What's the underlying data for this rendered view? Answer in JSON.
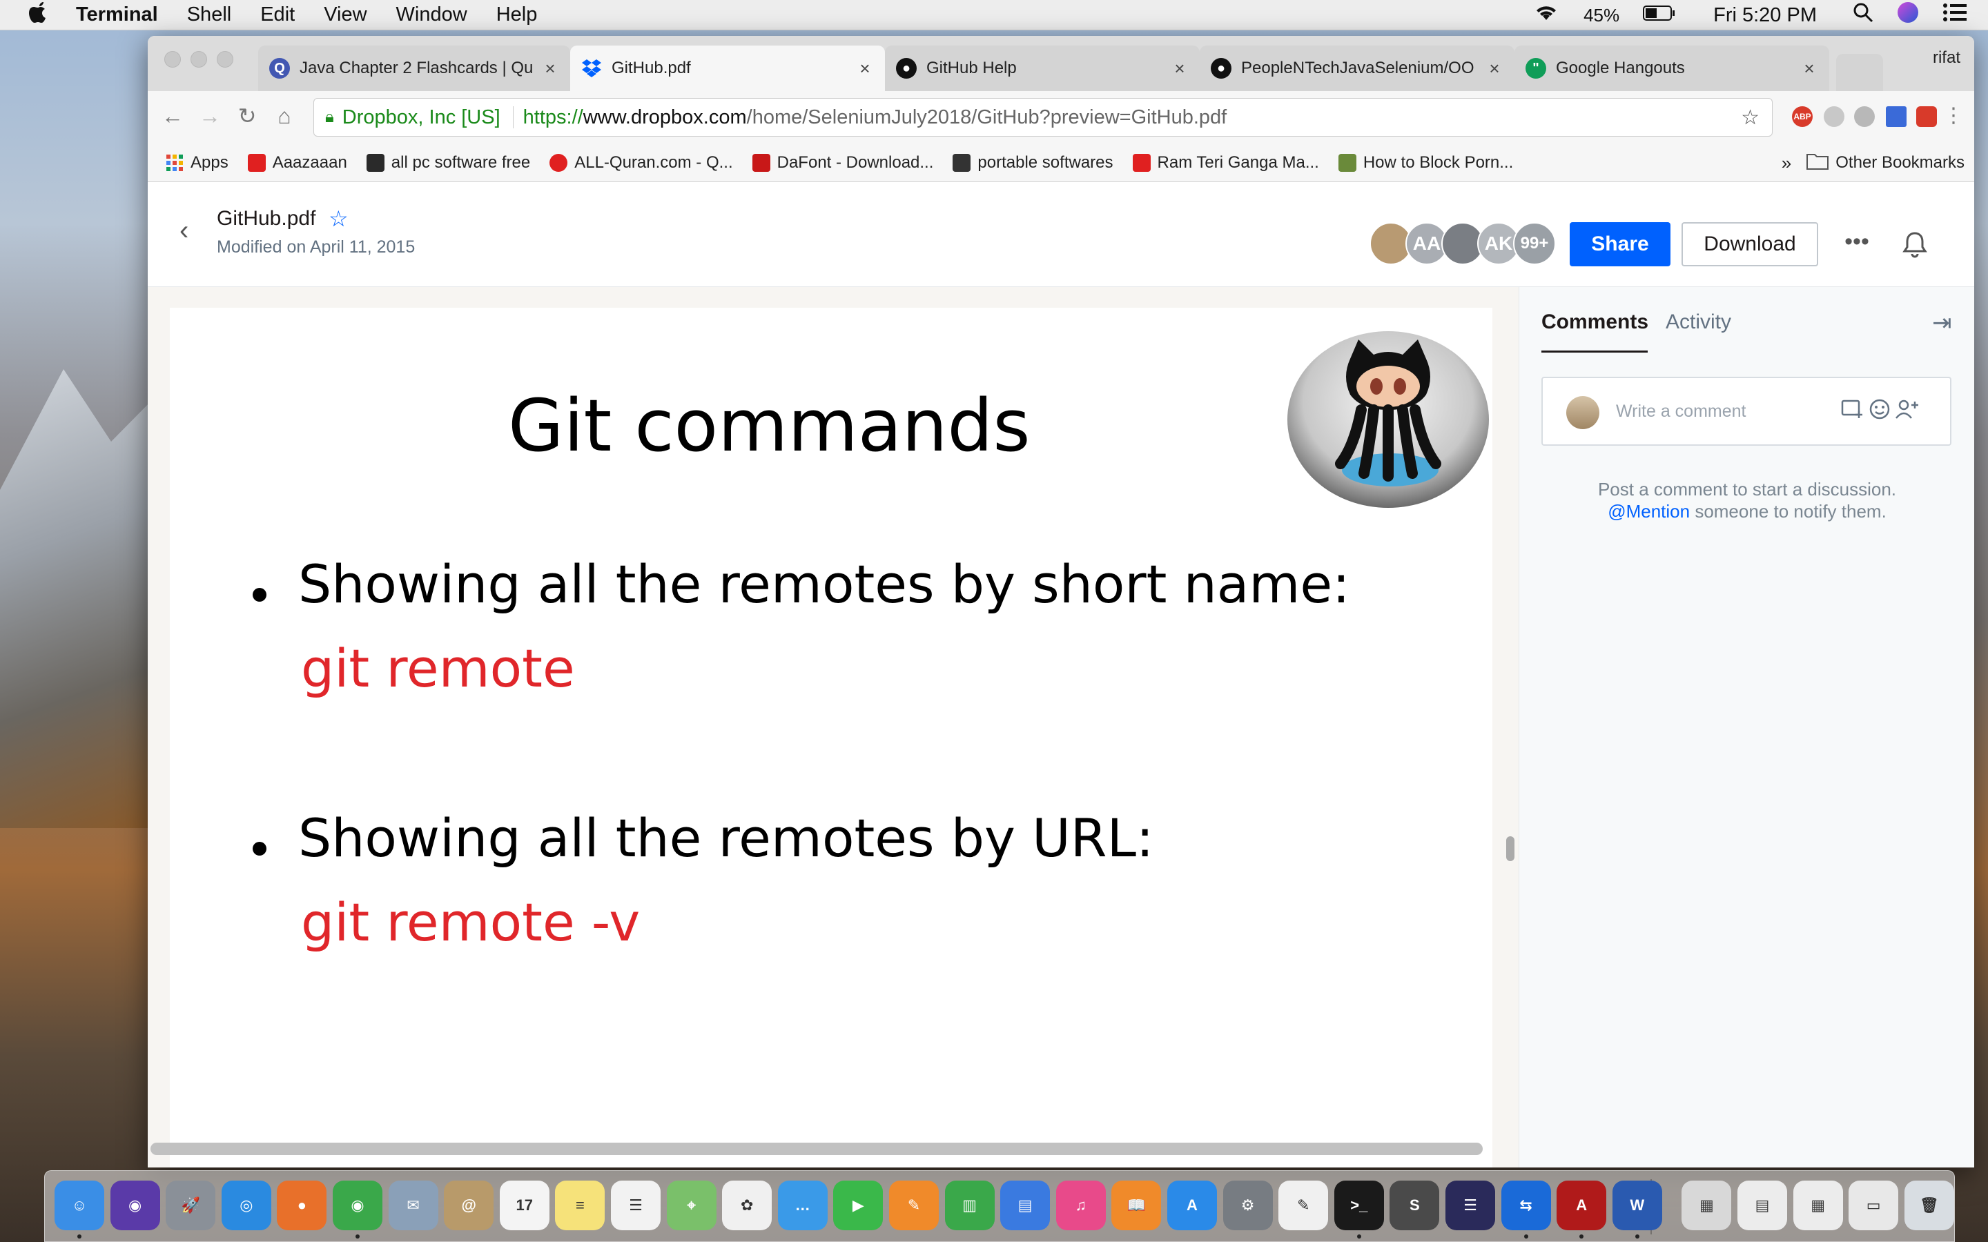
{
  "menubar": {
    "app_name": "Terminal",
    "items": [
      "Shell",
      "Edit",
      "View",
      "Window",
      "Help"
    ],
    "battery": "45%",
    "clock": "Fri 5:20 PM",
    "icons": [
      "apple-icon",
      "wifi-icon",
      "battery-icon",
      "spotlight-icon",
      "siri-icon",
      "notification-center-icon"
    ]
  },
  "browser": {
    "profile_name": "rifat",
    "tabs": [
      {
        "title": "Java Chapter 2 Flashcards | Qu",
        "icon": "quizlet-icon",
        "active": false
      },
      {
        "title": "GitHub.pdf",
        "icon": "dropbox-icon",
        "active": true
      },
      {
        "title": "GitHub Help",
        "icon": "github-icon",
        "active": false
      },
      {
        "title": "PeopleNTechJavaSelenium/OO",
        "icon": "github-icon",
        "active": false
      },
      {
        "title": "Google Hangouts",
        "icon": "hangouts-icon",
        "active": false
      }
    ],
    "omnibox": {
      "secure_label": "Dropbox, Inc [US]",
      "url_scheme": "https://",
      "url_host": "www.dropbox.com",
      "url_path": "/home/SeleniumJuly2018/GitHub?preview=GitHub.pdf"
    },
    "extensions": [
      "ABP",
      "ext2",
      "ext3",
      "ext4",
      "ext5"
    ],
    "bookmarks": [
      {
        "label": "Apps",
        "icon": "apps-grid-icon",
        "color": "#e0473a"
      },
      {
        "label": "Aaazaaan",
        "icon": "youtube-icon",
        "color": "#e02020"
      },
      {
        "label": "all pc software free",
        "icon": "g-icon",
        "color": "#2a2a2a"
      },
      {
        "label": "ALL-Quran.com - Q...",
        "icon": "quran-icon",
        "color": "#e02020"
      },
      {
        "label": "DaFont - Download...",
        "icon": "dafont-icon",
        "color": "#c81818"
      },
      {
        "label": "portable softwares",
        "icon": "portable-icon",
        "color": "#333333"
      },
      {
        "label": "Ram Teri Ganga Ma...",
        "icon": "youtube-icon",
        "color": "#e02020"
      },
      {
        "label": "How to Block Porn...",
        "icon": "wh-icon",
        "color": "#6a8a3a"
      }
    ],
    "bookmarks_overflow": "»",
    "other_bookmarks": "Other Bookmarks"
  },
  "dropbox": {
    "file_name": "GitHub.pdf",
    "modified": "Modified on April 11, 2015",
    "avatars": [
      {
        "label": "",
        "color": "#b89a72"
      },
      {
        "label": "AA",
        "color": "#a9adb3"
      },
      {
        "label": "",
        "color": "#7a7e84"
      },
      {
        "label": "AK",
        "color": "#b3b7bc"
      },
      {
        "label": "99+",
        "color": "#9aa0a6"
      }
    ],
    "share_label": "Share",
    "download_label": "Download",
    "more_label": "•••",
    "slide": {
      "title": "Git commands",
      "bullets": [
        {
          "text": "Showing all the remotes by short name:",
          "command": "git remote"
        },
        {
          "text": "Showing all the remotes by URL:",
          "command": "git remote -v"
        }
      ]
    },
    "sidebar": {
      "tabs": [
        "Comments",
        "Activity"
      ],
      "comment_placeholder": "Write a comment",
      "hint_line1": "Post a comment to start a discussion.",
      "hint_mention": "@Mention",
      "hint_line2_rest": " someone to notify them."
    }
  },
  "dock": {
    "apps": [
      {
        "name": "finder",
        "color": "#3a8ee6",
        "glyph": "☺"
      },
      {
        "name": "siri",
        "color": "#5a3aa8",
        "glyph": "◉"
      },
      {
        "name": "launchpad",
        "color": "#8a9098",
        "glyph": "🚀"
      },
      {
        "name": "safari",
        "color": "#2a8ae0",
        "glyph": "◎"
      },
      {
        "name": "firefox",
        "color": "#e8702a",
        "glyph": "●"
      },
      {
        "name": "chrome",
        "color": "#3aa84a",
        "glyph": "◉"
      },
      {
        "name": "mail-bird",
        "color": "#8aa0b8",
        "glyph": "✉"
      },
      {
        "name": "contacts",
        "color": "#b89a6a",
        "glyph": "@"
      },
      {
        "name": "calendar",
        "color": "#f4f4f4",
        "glyph": "17"
      },
      {
        "name": "notes",
        "color": "#f6e27a",
        "glyph": "≡"
      },
      {
        "name": "reminders",
        "color": "#f2f2f2",
        "glyph": "☰"
      },
      {
        "name": "maps",
        "color": "#7ac06a",
        "glyph": "⌖"
      },
      {
        "name": "photos",
        "color": "#f0f0f0",
        "glyph": "✿"
      },
      {
        "name": "messages",
        "color": "#3a9ae8",
        "glyph": "…"
      },
      {
        "name": "facetime",
        "color": "#3ab84a",
        "glyph": "▶"
      },
      {
        "name": "pages",
        "color": "#f08a2a",
        "glyph": "✎"
      },
      {
        "name": "numbers",
        "color": "#3aa84a",
        "glyph": "▥"
      },
      {
        "name": "keynote",
        "color": "#3a7ae0",
        "glyph": "▤"
      },
      {
        "name": "itunes",
        "color": "#e84a8a",
        "glyph": "♫"
      },
      {
        "name": "ibooks",
        "color": "#f08a2a",
        "glyph": "📖"
      },
      {
        "name": "app-store",
        "color": "#2a8ae8",
        "glyph": "A"
      },
      {
        "name": "system-preferences",
        "color": "#777c82",
        "glyph": "⚙"
      },
      {
        "name": "textedit",
        "color": "#f0f0f0",
        "glyph": "✎"
      },
      {
        "name": "terminal",
        "color": "#1a1a1a",
        "glyph": ">_"
      },
      {
        "name": "sublime-text",
        "color": "#4a4a4a",
        "glyph": "S"
      },
      {
        "name": "eclipse",
        "color": "#2a2a5a",
        "glyph": "☰"
      },
      {
        "name": "teamviewer",
        "color": "#1a6ad8",
        "glyph": "⇆"
      },
      {
        "name": "acrobat",
        "color": "#b01a1a",
        "glyph": "A"
      },
      {
        "name": "word",
        "color": "#2a5ab0",
        "glyph": "W"
      },
      {
        "name": "downloads-stack",
        "color": "#d8d8d8",
        "glyph": "▦"
      },
      {
        "name": "document-stack-1",
        "color": "#ececec",
        "glyph": "▤"
      },
      {
        "name": "document-stack-2",
        "color": "#ececec",
        "glyph": "▦"
      },
      {
        "name": "screenshot-stack",
        "color": "#e8e8e8",
        "glyph": "▭"
      },
      {
        "name": "trash",
        "color": "#d8dde2",
        "glyph": "🗑"
      }
    ],
    "running": [
      0,
      5,
      23,
      26,
      27,
      28
    ]
  }
}
